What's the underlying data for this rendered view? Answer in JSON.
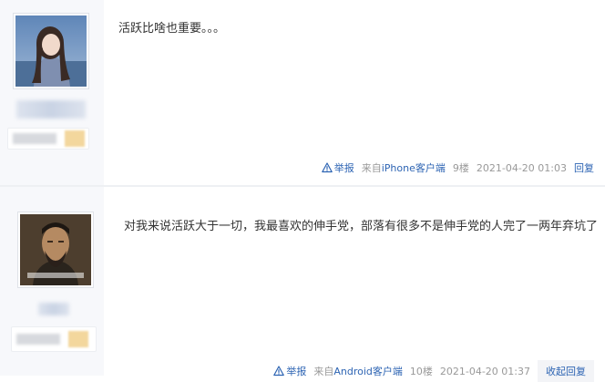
{
  "posts": [
    {
      "content": "活跃比啥也重要。。。",
      "tail": {
        "report": "举报",
        "source": "来自iPhone客户端",
        "floor": "9楼",
        "time": "2021-04-20 01:03",
        "reply": "回复"
      }
    },
    {
      "content": "对我来说活跃大于一切，我最喜欢的伸手党，部落有很多不是伸手党的人完了一两年弃坑了",
      "tail": {
        "report": "举报",
        "source": "来自Android客户端",
        "floor": "10楼",
        "time": "2021-04-20 01:37",
        "reply": "收起回复"
      }
    }
  ],
  "colors": {
    "link": "#2d64b3",
    "meta": "#999999",
    "left_column": "#f7f8fb"
  },
  "icons": [
    "warning-triangle-icon"
  ]
}
